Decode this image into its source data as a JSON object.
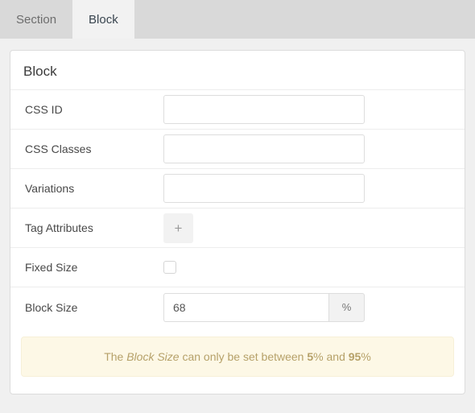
{
  "tabs": [
    {
      "label": "Section",
      "active": false
    },
    {
      "label": "Block",
      "active": true
    }
  ],
  "panel": {
    "title": "Block",
    "rows": [
      {
        "label": "CSS ID",
        "type": "text",
        "value": "",
        "placeholder": ""
      },
      {
        "label": "CSS Classes",
        "type": "text",
        "value": "",
        "placeholder": ""
      },
      {
        "label": "Variations",
        "type": "text",
        "value": "",
        "placeholder": ""
      },
      {
        "label": "Tag Attributes",
        "type": "button",
        "button_label": "+"
      },
      {
        "label": "Fixed Size",
        "type": "checkbox",
        "checked": false
      },
      {
        "label": "Block Size",
        "type": "number_addon",
        "value": "68",
        "addon": "%"
      }
    ],
    "notice": {
      "text_1": "The ",
      "emphasis": "Block Size",
      "text_2": " can only be set between ",
      "min": "5",
      "text_3": "% and ",
      "max": "95",
      "text_4": "%"
    }
  },
  "colors": {
    "page_background": "#f0f0f0",
    "tabbar_background": "#d9d9d9",
    "active_tab_background": "#f2f2f2",
    "panel_background": "#ffffff",
    "notice_background": "#fdf8e6",
    "notice_text": "#b6a169",
    "label_text": "#484848"
  }
}
